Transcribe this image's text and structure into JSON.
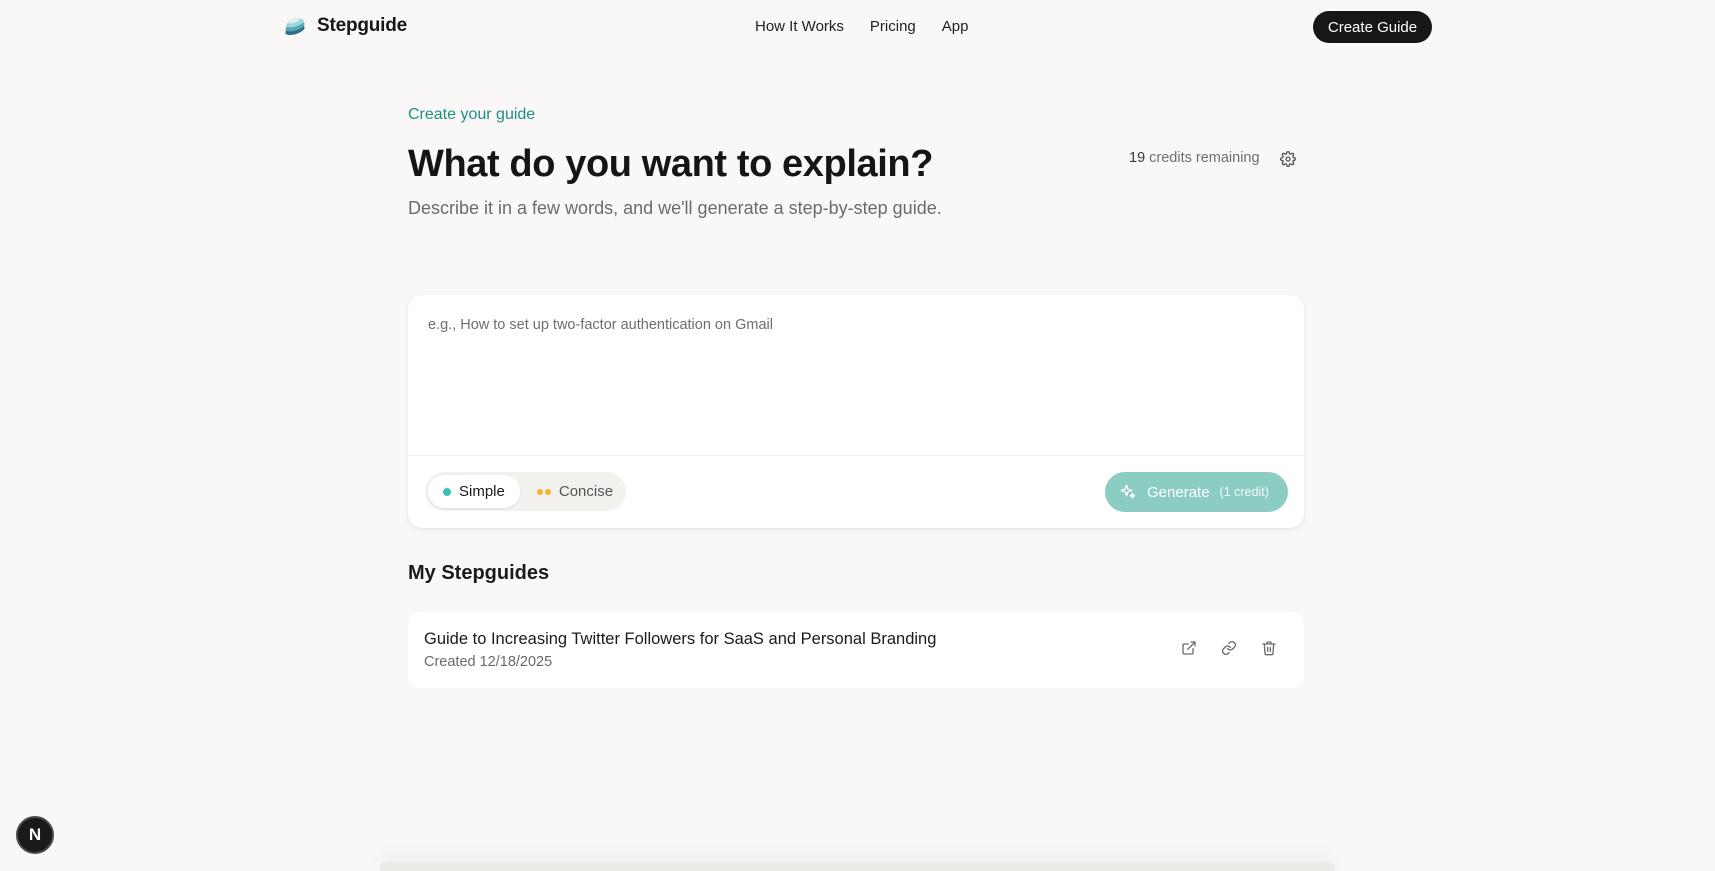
{
  "brand": {
    "name": "Stepguide"
  },
  "nav": {
    "links": [
      {
        "label": "How It Works"
      },
      {
        "label": "Pricing"
      },
      {
        "label": "App"
      }
    ],
    "cta_label": "Create Guide"
  },
  "hero": {
    "eyebrow": "Create your guide",
    "title": "What do you want to explain?",
    "subtitle": "Describe it in a few words, and we'll generate a step-by-step guide."
  },
  "credits": {
    "count": "19",
    "suffix": "credits remaining"
  },
  "composer": {
    "placeholder": "e.g., How to set up two-factor authentication on Gmail",
    "value": "",
    "modes": [
      {
        "label": "Simple",
        "active": true
      },
      {
        "label": "Concise",
        "active": false
      }
    ],
    "generate_label": "Generate",
    "generate_cost": "(1 credit)"
  },
  "guides": {
    "section_title": "My Stepguides",
    "items": [
      {
        "title": "Guide to Increasing Twitter Followers for SaaS and Personal Branding",
        "created": "Created 12/18/2025"
      }
    ]
  },
  "badge": {
    "letter": "N"
  },
  "colors": {
    "accent": "#1f8f82",
    "generate_disabled": "#8ccdc3",
    "background": "#f9f8f6",
    "dark": "#171717"
  }
}
